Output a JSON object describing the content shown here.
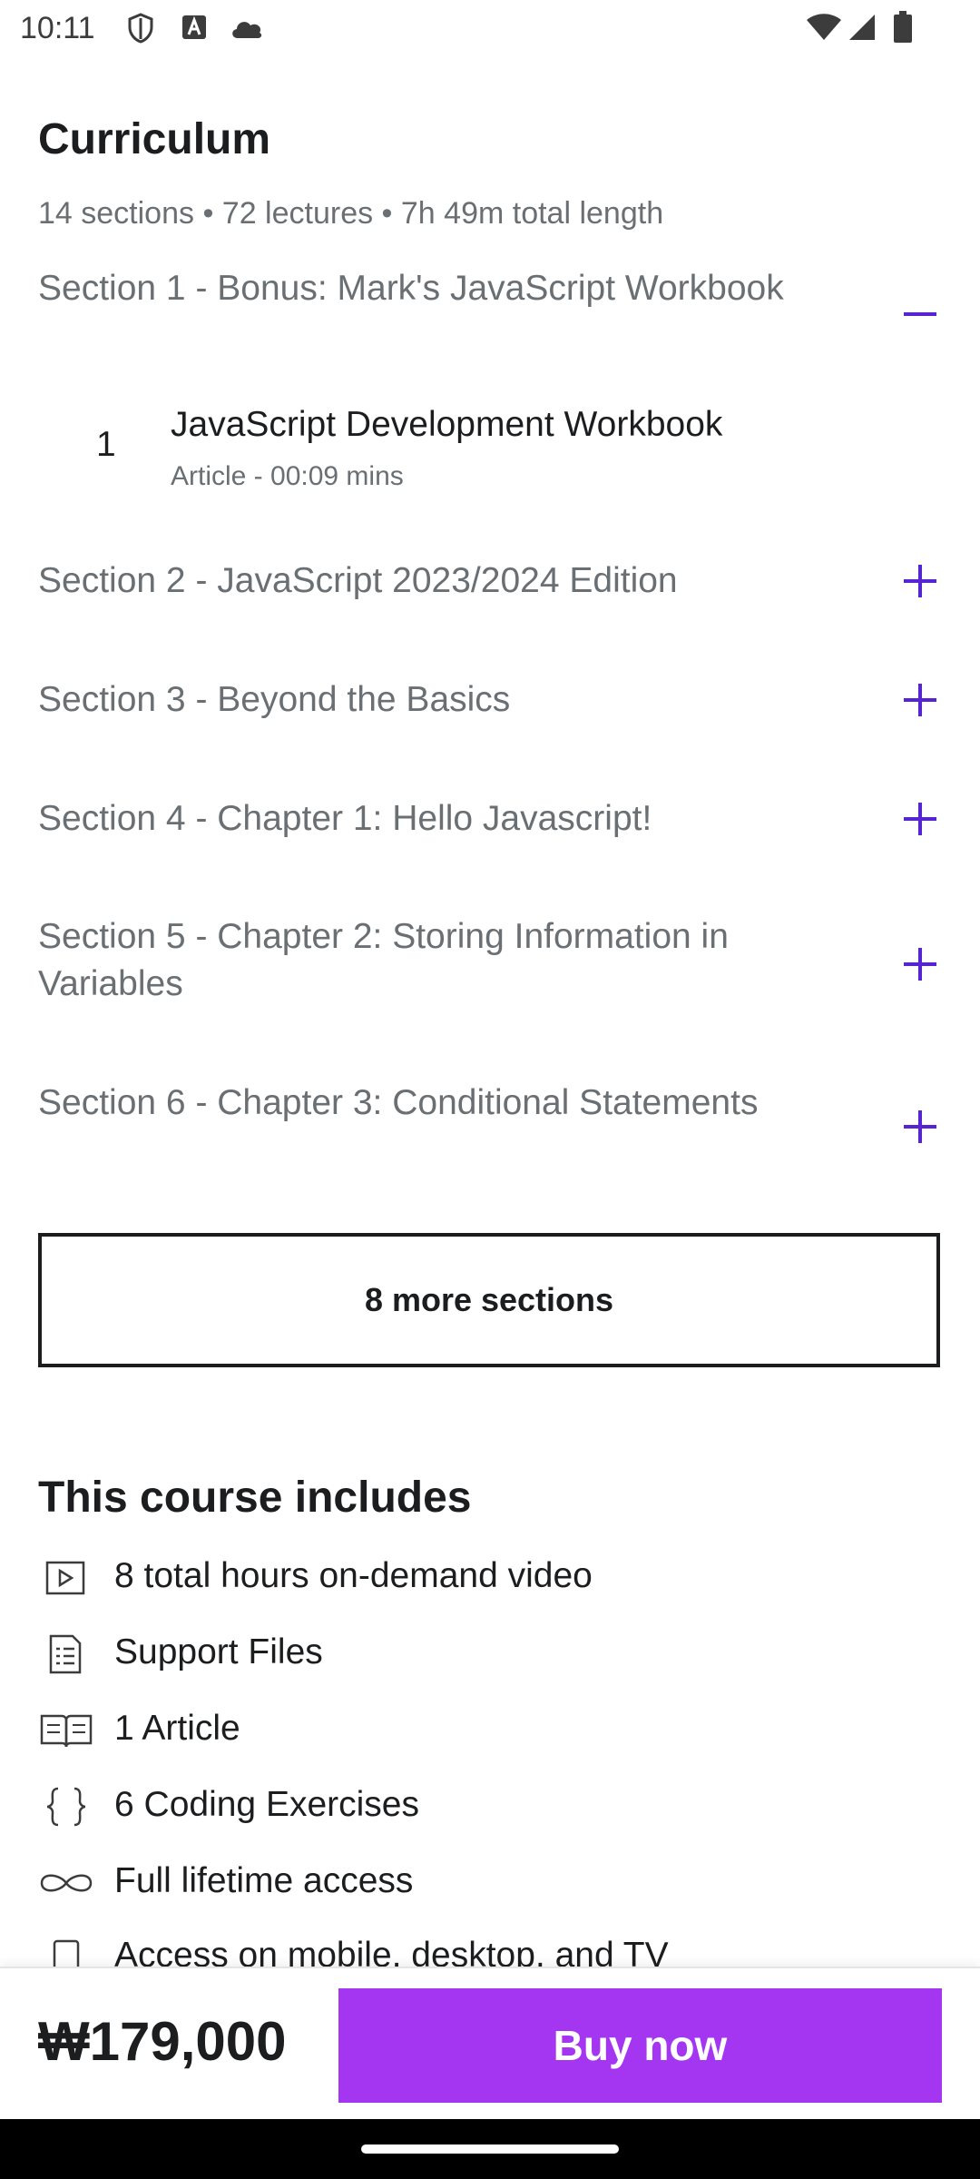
{
  "status_bar": {
    "time": "10:11",
    "left_icons": [
      "shield-icon",
      "text-a-icon",
      "cloud-icon"
    ],
    "right_icons": [
      "wifi-icon",
      "signal-icon",
      "battery-icon"
    ]
  },
  "curriculum": {
    "title": "Curriculum",
    "summary": "14 sections • 72 lectures • 7h 49m total length",
    "sections": [
      {
        "title": "Section 1 - Bonus:  Mark's JavaScript Workbook",
        "expanded": true
      },
      {
        "title": "Section 2 - JavaScript 2023/2024 Edition",
        "expanded": false
      },
      {
        "title": "Section 3 - Beyond the Basics",
        "expanded": false
      },
      {
        "title": "Section 4 - Chapter 1:  Hello Javascript!",
        "expanded": false
      },
      {
        "title": "Section 5 - Chapter 2: Storing Information in Variables",
        "expanded": false
      },
      {
        "title": "Section 6 - Chapter 3: Conditional Statements",
        "expanded": false
      }
    ],
    "lectures": [
      {
        "number": "1",
        "title": "JavaScript Development Workbook",
        "meta": "Article - 00:09 mins"
      }
    ],
    "more_sections_label": "8 more sections"
  },
  "includes": {
    "title": "This course includes",
    "items": [
      {
        "icon": "video-icon",
        "label": "8 total hours on-demand video"
      },
      {
        "icon": "file-icon",
        "label": "Support Files"
      },
      {
        "icon": "book-icon",
        "label": "1 Article"
      },
      {
        "icon": "braces-icon",
        "label": "6 Coding Exercises"
      },
      {
        "icon": "infinity-icon",
        "label": "Full lifetime access"
      },
      {
        "icon": "mobile-icon",
        "label": "Access on mobile, desktop, and TV"
      }
    ]
  },
  "purchase": {
    "price": "₩179,000",
    "buy_label": "Buy now"
  },
  "colors": {
    "accent": "#5624d0",
    "buy_button": "#a435f0",
    "text_primary": "#1c1d1f",
    "text_secondary": "#6a6f73"
  }
}
